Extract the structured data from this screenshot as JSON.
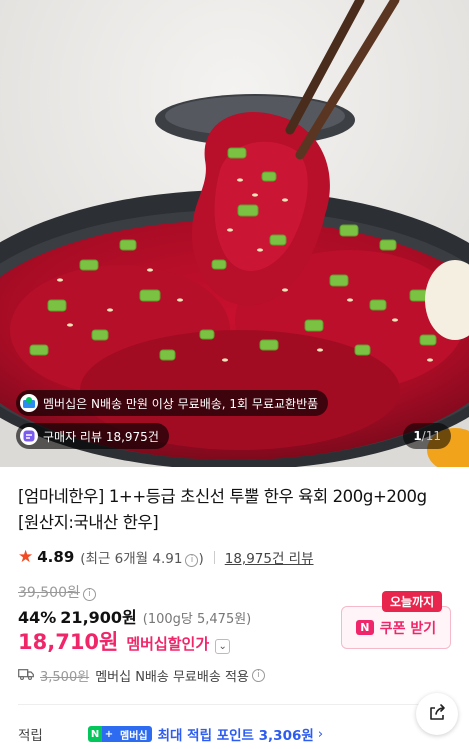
{
  "hero": {
    "chips": {
      "membership_text": "멤버십은 N배송 만원 이상 무료배송, 1회 무료교환반품",
      "review_text": "구매자 리뷰 18,975건"
    },
    "counter": {
      "current": "1",
      "separator": "/",
      "total": "11"
    }
  },
  "product": {
    "title_line1": "[엄마네한우] 1++등급 초신선 투뿔 한우 육회 200g+200g",
    "title_line2": "[원산지:국내산 한우]"
  },
  "rating": {
    "score": "4.89",
    "recent": "(최근 6개월 4.91",
    "recent_close": ")",
    "reviews_link": "18,975건 리뷰"
  },
  "price": {
    "original": "39,500원",
    "discount_pct": "44%",
    "sale_price": "21,900원",
    "unit_price": "(100g당 5,475원)",
    "member_price": "18,710원",
    "member_label": "멤버십할인가"
  },
  "coupon": {
    "badge": "오늘까지",
    "logo": "N",
    "label": "쿠폰 받기"
  },
  "shipping": {
    "original_fee": "3,500원",
    "text": "멤버십 N배송 무료배송 적용"
  },
  "points": {
    "label": "적립",
    "badge_n": "N",
    "badge_plus": "+",
    "badge_member": "멤버십",
    "text": "최대 적립 포인트 3,306원",
    "arrow": "›"
  },
  "colors": {
    "accent": "#f0266a",
    "star": "#f04b23",
    "points_blue": "#2d5cf0",
    "naver_green": "#03c75a"
  },
  "icons": {
    "star": "star-icon",
    "info": "info-icon",
    "chevron": "chevron-down-icon",
    "truck": "truck-icon",
    "share": "share-icon"
  }
}
